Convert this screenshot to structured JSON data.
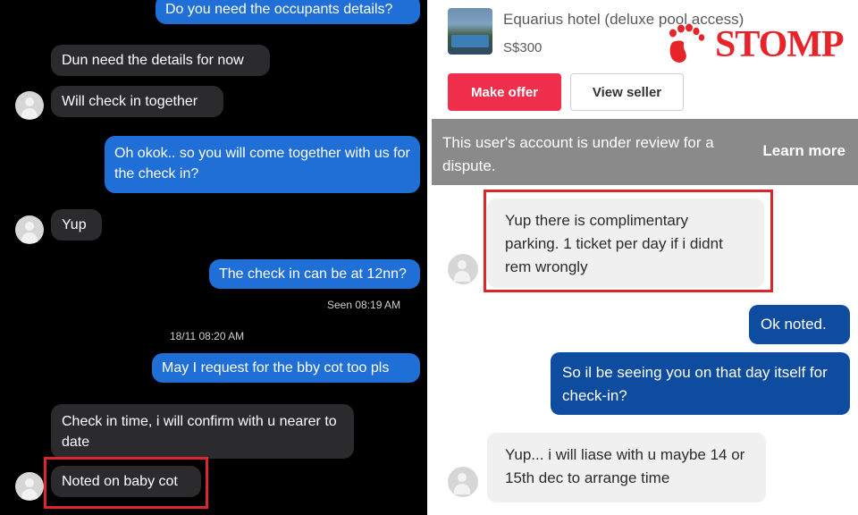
{
  "left_chat": {
    "messages": [
      {
        "id": "m1",
        "direction": "outgoing",
        "text": "Do you need the occupants details?"
      },
      {
        "id": "m2",
        "direction": "incoming",
        "text": "Dun need the details for now"
      },
      {
        "id": "m3",
        "direction": "incoming",
        "text": "Will check in together"
      },
      {
        "id": "m4",
        "direction": "outgoing",
        "text": "Oh okok.. so you will come together with us for the check in?"
      },
      {
        "id": "m5",
        "direction": "incoming",
        "text": "Yup"
      },
      {
        "id": "m6",
        "direction": "outgoing",
        "text": "The check in can be at 12nn?"
      },
      {
        "id": "m7",
        "direction": "outgoing",
        "text": "May I request for the bby cot too pls"
      },
      {
        "id": "m8",
        "direction": "incoming",
        "text": "Check in time, i will confirm with u nearer to date"
      },
      {
        "id": "m9",
        "direction": "incoming",
        "text": "Noted on baby cot"
      }
    ],
    "seen_status": "Seen 08:19 AM",
    "timestamp": "18/11 08:20 AM"
  },
  "right_chat": {
    "listing": {
      "title": "Equarius hotel (deluxe pool access)",
      "price": "S$300"
    },
    "buttons": {
      "make_offer": "Make offer",
      "view_seller": "View seller"
    },
    "banner": {
      "text": "This user's account is under review for a dispute.",
      "link": "Learn more"
    },
    "messages": [
      {
        "id": "r1",
        "direction": "incoming",
        "text": "Yup there is complimentary parking. 1 ticket per day if i didnt rem wrongly"
      },
      {
        "id": "r2",
        "direction": "outgoing",
        "text": "Ok noted."
      },
      {
        "id": "r3",
        "direction": "outgoing",
        "text": "So il be seeing you on that day itself for check-in?"
      },
      {
        "id": "r4",
        "direction": "incoming",
        "text": "Yup... i will liase with u maybe 14 or 15th dec to arrange time"
      }
    ]
  },
  "watermark": {
    "brand": "STOMP"
  },
  "colors": {
    "outgoing_left": "#1f6fd6",
    "incoming_left": "#2b2b2d",
    "outgoing_right": "#0e4ca0",
    "incoming_right": "#f0f0f0",
    "make_offer": "#ef2f4b",
    "highlight_box": "#d9252b",
    "banner": "#8a8a8a"
  }
}
